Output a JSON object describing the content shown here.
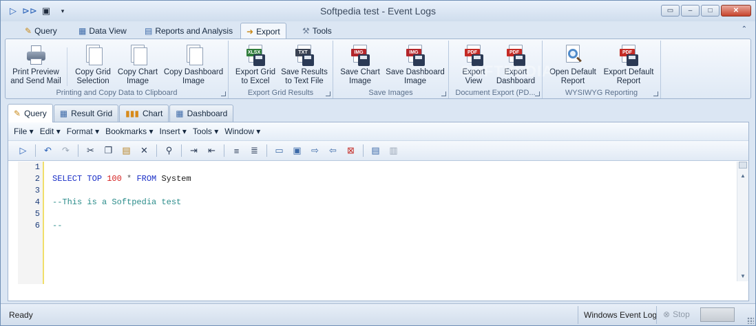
{
  "window": {
    "title": "Softpedia test - Event Logs"
  },
  "quick_access": [
    "play-icon",
    "run-all-icon",
    "save-icon",
    "customize-icon"
  ],
  "window_controls": [
    "restore-to-tray-icon",
    "minimize-icon",
    "maximize-icon",
    "close-icon"
  ],
  "ribbon_tabs": [
    {
      "label": "Query",
      "icon": "query-icon"
    },
    {
      "label": "Data View",
      "icon": "data-view-icon"
    },
    {
      "label": "Reports and Analysis",
      "icon": "reports-icon"
    },
    {
      "label": "Export",
      "icon": "export-icon",
      "active": true
    },
    {
      "label": "Tools",
      "icon": "tools-icon"
    }
  ],
  "ribbon_groups": [
    {
      "caption": "Printing and Copy Data to Clipboard",
      "buttons": [
        "Print Preview\nand Send Mail",
        "Copy Grid\nSelection",
        "Copy Chart\nImage",
        "Copy Dashboard\nImage"
      ]
    },
    {
      "caption": "Export Grid Results",
      "buttons": [
        "Export Grid\nto Excel",
        "Save Results\nto Text File"
      ]
    },
    {
      "caption": "Save Images",
      "buttons": [
        "Save Chart\nImage",
        "Save Dashboard\nImage"
      ]
    },
    {
      "caption": "Document Export (PD...",
      "buttons": [
        "Export\nView",
        "Export\nDashboard"
      ]
    },
    {
      "caption": "WYSIWYG Reporting",
      "buttons": [
        "Open Default\nReport",
        "Export Default\nReport"
      ]
    }
  ],
  "badges": {
    "xlsx": "XLSX",
    "txt": "TXT",
    "img": "IMG",
    "pdf": "PDF"
  },
  "doc_tabs": [
    {
      "label": "Query",
      "active": true
    },
    {
      "label": "Result Grid"
    },
    {
      "label": "Chart"
    },
    {
      "label": "Dashboard"
    }
  ],
  "menus": [
    "File",
    "Edit",
    "Format",
    "Bookmarks",
    "Insert",
    "Tools",
    "Window"
  ],
  "editor": {
    "line_numbers": [
      "1",
      "2",
      "3",
      "4",
      "5",
      "6"
    ],
    "lines": [
      [],
      [
        {
          "t": "SELECT",
          "c": "kw"
        },
        {
          "t": " ",
          "c": "id"
        },
        {
          "t": "TOP",
          "c": "kw"
        },
        {
          "t": " ",
          "c": "id"
        },
        {
          "t": "100",
          "c": "num"
        },
        {
          "t": " ",
          "c": "id"
        },
        {
          "t": "*",
          "c": "op"
        },
        {
          "t": " ",
          "c": "id"
        },
        {
          "t": "FROM",
          "c": "kw"
        },
        {
          "t": " System",
          "c": "id"
        }
      ],
      [],
      [
        {
          "t": "--This is a Softpedia test",
          "c": "cm"
        }
      ],
      [],
      [
        {
          "t": "--",
          "c": "cm"
        }
      ]
    ]
  },
  "statusbar": {
    "ready": "Ready",
    "log": "Windows Event Log",
    "stop": "Stop"
  },
  "watermark": "SOFTPEDIA"
}
